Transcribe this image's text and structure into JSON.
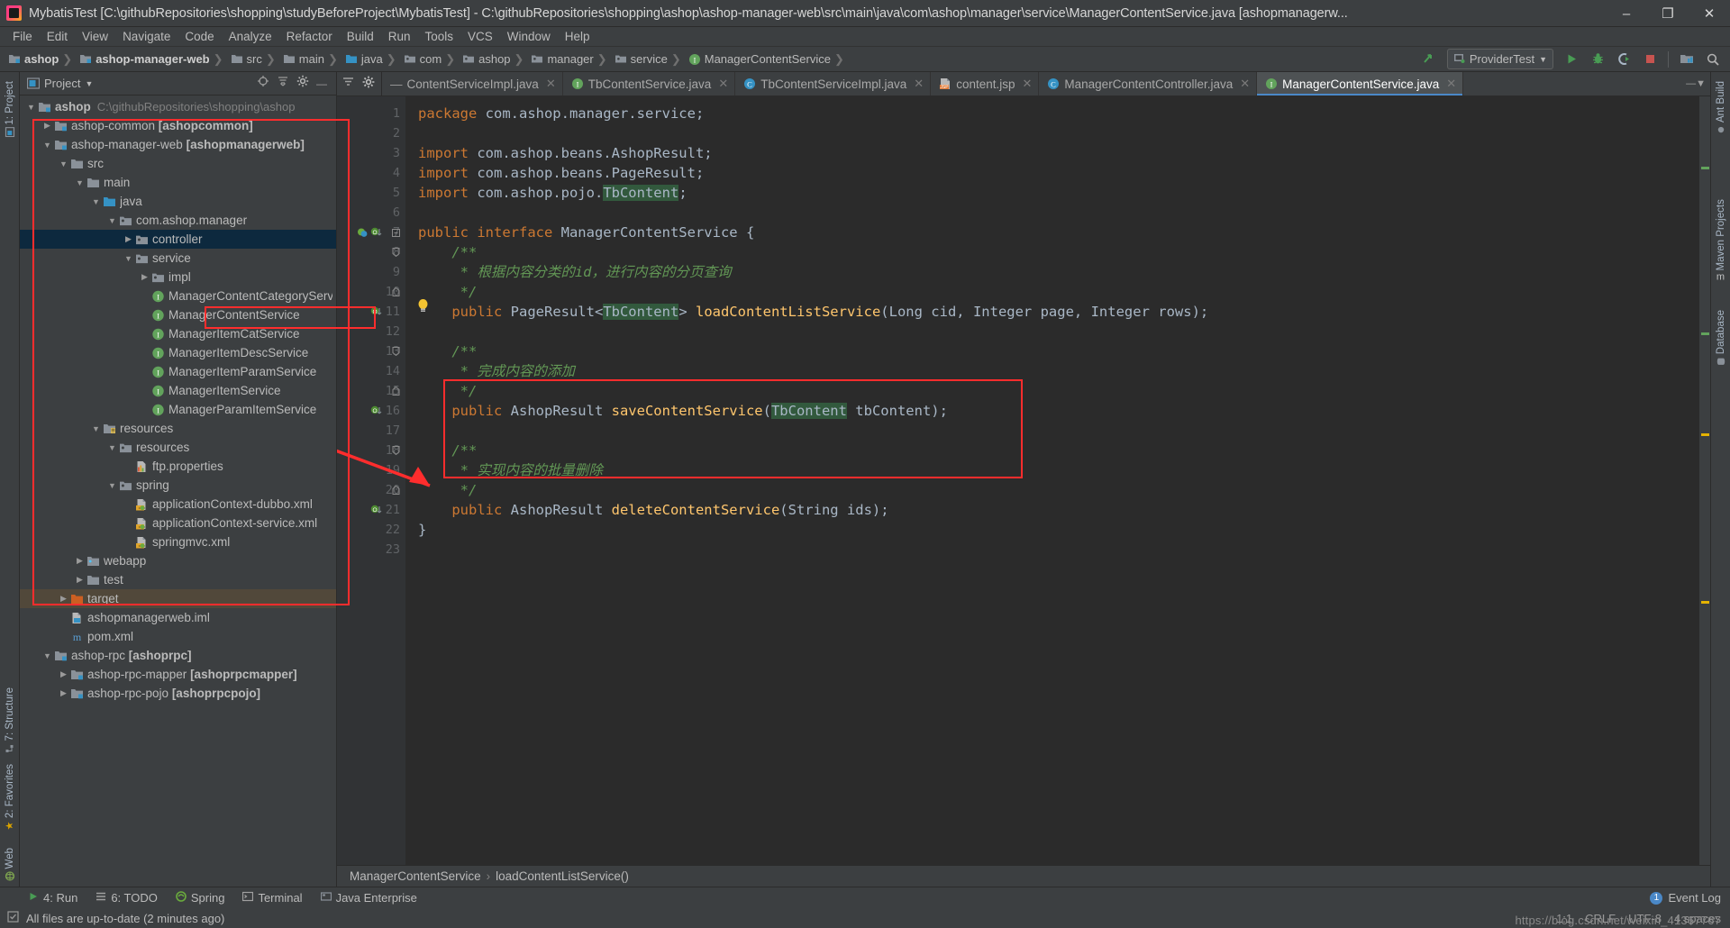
{
  "titlebar": {
    "title": "MybatisTest [C:\\githubRepositories\\shopping\\studyBeforeProject\\MybatisTest] - C:\\githubRepositories\\shopping\\ashop\\ashop-manager-web\\src\\main\\java\\com\\ashop\\manager\\service\\ManagerContentService.java [ashopmanagerw...",
    "minimize": "–",
    "maximize": "❐",
    "close": "✕"
  },
  "menubar": {
    "items": [
      "File",
      "Edit",
      "View",
      "Navigate",
      "Code",
      "Analyze",
      "Refactor",
      "Build",
      "Run",
      "Tools",
      "VCS",
      "Window",
      "Help"
    ]
  },
  "navbar": {
    "crumbs": [
      {
        "label": "ashop",
        "icon": "module-folder-icon",
        "bold": true
      },
      {
        "label": "ashop-manager-web",
        "icon": "module-folder-icon",
        "bold": true
      },
      {
        "label": "src",
        "icon": "folder-icon",
        "bold": false
      },
      {
        "label": "main",
        "icon": "folder-icon",
        "bold": false
      },
      {
        "label": "java",
        "icon": "source-folder-icon",
        "bold": false
      },
      {
        "label": "com",
        "icon": "package-icon",
        "bold": false
      },
      {
        "label": "ashop",
        "icon": "package-icon",
        "bold": false
      },
      {
        "label": "manager",
        "icon": "package-icon",
        "bold": false
      },
      {
        "label": "service",
        "icon": "package-icon",
        "bold": false
      },
      {
        "label": "ManagerContentService",
        "icon": "interface-icon",
        "bold": false
      }
    ],
    "run_config": "ProviderTest",
    "buttons": [
      "update-project-icon",
      "run-icon",
      "debug-icon",
      "run-coverage-icon",
      "stop-icon",
      "project-structure-icon",
      "search-everywhere-icon"
    ]
  },
  "left_strip": {
    "top_tabs": [
      {
        "label": "1: Project",
        "icon": "project-icon"
      }
    ],
    "bottom_tabs": [
      {
        "label": "7: Structure",
        "icon": "structure-icon"
      },
      {
        "label": "2: Favorites",
        "icon": "favorites-icon"
      },
      {
        "label": "Web",
        "icon": "web-icon"
      }
    ]
  },
  "right_strip": {
    "tabs": [
      {
        "label": "Ant Build",
        "icon": "ant-icon"
      },
      {
        "label": "Maven Projects",
        "icon": "maven-icon"
      },
      {
        "label": "Database",
        "icon": "database-icon"
      }
    ]
  },
  "project_panel": {
    "title": "Project",
    "header_icons": [
      "target-icon",
      "collapse-all-icon",
      "settings-icon",
      "hide-icon"
    ],
    "tree": [
      {
        "indent": 0,
        "arrow": "down",
        "icon": "module-folder-icon",
        "label": "ashop",
        "bold": true,
        "path": "C:\\githubRepositories\\shopping\\ashop",
        "state": "normal"
      },
      {
        "indent": 1,
        "arrow": "right",
        "icon": "module-folder-icon",
        "label": "ashop-common [ashopcommon]",
        "bold_part": "[ashopcommon]",
        "state": "normal"
      },
      {
        "indent": 1,
        "arrow": "down",
        "icon": "module-folder-icon",
        "label": "ashop-manager-web [ashopmanagerweb]",
        "bold_part": "[ashopmanagerweb]",
        "state": "normal"
      },
      {
        "indent": 2,
        "arrow": "down",
        "icon": "folder-icon",
        "label": "src",
        "state": "normal"
      },
      {
        "indent": 3,
        "arrow": "down",
        "icon": "folder-icon",
        "label": "main",
        "state": "normal"
      },
      {
        "indent": 4,
        "arrow": "down",
        "icon": "source-folder-icon",
        "label": "java",
        "state": "normal"
      },
      {
        "indent": 5,
        "arrow": "down",
        "icon": "package-icon",
        "label": "com.ashop.manager",
        "state": "normal"
      },
      {
        "indent": 6,
        "arrow": "right",
        "icon": "package-icon",
        "label": "controller",
        "state": "selected"
      },
      {
        "indent": 6,
        "arrow": "down",
        "icon": "package-icon",
        "label": "service",
        "state": "normal"
      },
      {
        "indent": 7,
        "arrow": "right",
        "icon": "package-icon",
        "label": "impl",
        "state": "normal"
      },
      {
        "indent": 7,
        "arrow": "none",
        "icon": "interface-icon",
        "label": "ManagerContentCategoryService",
        "state": "normal"
      },
      {
        "indent": 7,
        "arrow": "none",
        "icon": "interface-icon",
        "label": "ManagerContentService",
        "state": "annotated"
      },
      {
        "indent": 7,
        "arrow": "none",
        "icon": "interface-icon",
        "label": "ManagerItemCatService",
        "state": "normal"
      },
      {
        "indent": 7,
        "arrow": "none",
        "icon": "interface-icon",
        "label": "ManagerItemDescService",
        "state": "normal"
      },
      {
        "indent": 7,
        "arrow": "none",
        "icon": "interface-icon",
        "label": "ManagerItemParamService",
        "state": "normal"
      },
      {
        "indent": 7,
        "arrow": "none",
        "icon": "interface-icon",
        "label": "ManagerItemService",
        "state": "normal"
      },
      {
        "indent": 7,
        "arrow": "none",
        "icon": "interface-icon",
        "label": "ManagerParamItemService",
        "state": "normal"
      },
      {
        "indent": 4,
        "arrow": "down",
        "icon": "resource-folder-icon",
        "label": "resources",
        "state": "normal"
      },
      {
        "indent": 5,
        "arrow": "down",
        "icon": "package-icon",
        "label": "resources",
        "state": "normal"
      },
      {
        "indent": 6,
        "arrow": "none",
        "icon": "properties-icon",
        "label": "ftp.properties",
        "state": "normal"
      },
      {
        "indent": 5,
        "arrow": "down",
        "icon": "package-icon",
        "label": "spring",
        "state": "normal"
      },
      {
        "indent": 6,
        "arrow": "none",
        "icon": "spring-xml-icon",
        "label": "applicationContext-dubbo.xml",
        "state": "normal"
      },
      {
        "indent": 6,
        "arrow": "none",
        "icon": "spring-xml-icon",
        "label": "applicationContext-service.xml",
        "state": "normal"
      },
      {
        "indent": 6,
        "arrow": "none",
        "icon": "spring-xml-icon",
        "label": "springmvc.xml",
        "state": "normal"
      },
      {
        "indent": 3,
        "arrow": "right",
        "icon": "webapp-folder-icon",
        "label": "webapp",
        "state": "normal"
      },
      {
        "indent": 3,
        "arrow": "right",
        "icon": "folder-icon",
        "label": "test",
        "state": "normal"
      },
      {
        "indent": 2,
        "arrow": "right",
        "icon": "target-folder-icon",
        "label": "target",
        "state": "highlighted"
      },
      {
        "indent": 2,
        "arrow": "none",
        "icon": "iml-icon",
        "label": "ashopmanagerweb.iml",
        "state": "normal"
      },
      {
        "indent": 2,
        "arrow": "none",
        "icon": "maven-pom-icon",
        "label": "pom.xml",
        "state": "normal"
      },
      {
        "indent": 1,
        "arrow": "down",
        "icon": "module-folder-icon",
        "label": "ashop-rpc [ashoprpc]",
        "bold_part": "[ashoprpc]",
        "state": "normal"
      },
      {
        "indent": 2,
        "arrow": "right",
        "icon": "module-folder-icon",
        "label": "ashop-rpc-mapper [ashoprpcmapper]",
        "bold_part": "[ashoprpcmapper]",
        "state": "normal"
      },
      {
        "indent": 2,
        "arrow": "right",
        "icon": "module-folder-icon",
        "label": "ashop-rpc-pojo [ashoprpcpojo]",
        "bold_part": "[ashoprpcpojo]",
        "state": "normal"
      }
    ]
  },
  "editor": {
    "tabs": [
      {
        "label": "ContentServiceImpl.java",
        "icon": "minus-icon",
        "active": false,
        "closable": true
      },
      {
        "label": "TbContentService.java",
        "icon": "interface-icon",
        "active": false,
        "closable": true
      },
      {
        "label": "TbContentServiceImpl.java",
        "icon": "class-icon",
        "active": false,
        "closable": true
      },
      {
        "label": "content.jsp",
        "icon": "jsp-icon",
        "active": false,
        "closable": true
      },
      {
        "label": "ManagerContentController.java",
        "icon": "class-icon",
        "active": false,
        "closable": true
      },
      {
        "label": "ManagerContentService.java",
        "icon": "interface-icon",
        "active": true,
        "closable": true
      }
    ],
    "line_numbers": [
      1,
      2,
      3,
      4,
      5,
      6,
      7,
      8,
      9,
      10,
      11,
      12,
      13,
      14,
      15,
      16,
      17,
      18,
      19,
      20,
      21,
      22,
      23
    ],
    "code_lines": [
      {
        "n": 1,
        "segments": [
          {
            "t": "package ",
            "c": "kw"
          },
          {
            "t": "com.ashop.manager.service",
            "c": "ident"
          },
          {
            "t": ";",
            "c": "ident"
          }
        ]
      },
      {
        "n": 2,
        "segments": []
      },
      {
        "n": 3,
        "segments": [
          {
            "t": "import ",
            "c": "kw"
          },
          {
            "t": "com.ashop.beans.AshopResult;",
            "c": "ident"
          }
        ]
      },
      {
        "n": 4,
        "segments": [
          {
            "t": "import ",
            "c": "kw"
          },
          {
            "t": "com.ashop.beans.PageResult;",
            "c": "ident"
          }
        ]
      },
      {
        "n": 5,
        "segments": [
          {
            "t": "import ",
            "c": "kw"
          },
          {
            "t": "com.ashop.pojo.",
            "c": "ident"
          },
          {
            "t": "TbContent",
            "c": "hl"
          },
          {
            "t": ";",
            "c": "ident"
          }
        ]
      },
      {
        "n": 6,
        "segments": []
      },
      {
        "n": 7,
        "segments": [
          {
            "t": "public interface ",
            "c": "kw"
          },
          {
            "t": "ManagerContentService",
            "c": "ident"
          },
          {
            "t": " {",
            "c": "ident"
          }
        ]
      },
      {
        "n": 8,
        "segments": [
          {
            "t": "    /**",
            "c": "cmt"
          }
        ]
      },
      {
        "n": 9,
        "segments": [
          {
            "t": "     * 根据内容分类的id，进行内容的分页查询",
            "c": "cmt"
          }
        ]
      },
      {
        "n": 10,
        "segments": [
          {
            "t": "     */",
            "c": "cmt"
          }
        ]
      },
      {
        "n": 11,
        "segments": [
          {
            "t": "    public ",
            "c": "kw"
          },
          {
            "t": "PageResult<",
            "c": "ident"
          },
          {
            "t": "TbContent",
            "c": "hl"
          },
          {
            "t": "> ",
            "c": "ident"
          },
          {
            "t": "loadContentListService",
            "c": "mth"
          },
          {
            "t": "(Long cid, Integer page, Integer rows);",
            "c": "ident"
          }
        ]
      },
      {
        "n": 12,
        "segments": []
      },
      {
        "n": 13,
        "segments": [
          {
            "t": "    /**",
            "c": "cmt"
          }
        ]
      },
      {
        "n": 14,
        "segments": [
          {
            "t": "     * 完成内容的添加",
            "c": "cmt"
          }
        ]
      },
      {
        "n": 15,
        "segments": [
          {
            "t": "     */",
            "c": "cmt"
          }
        ]
      },
      {
        "n": 16,
        "segments": [
          {
            "t": "    public ",
            "c": "kw"
          },
          {
            "t": "AshopResult ",
            "c": "ident"
          },
          {
            "t": "saveContentService",
            "c": "mth"
          },
          {
            "t": "(",
            "c": "ident"
          },
          {
            "t": "TbContent",
            "c": "hl"
          },
          {
            "t": " tbContent);",
            "c": "ident"
          }
        ]
      },
      {
        "n": 17,
        "segments": []
      },
      {
        "n": 18,
        "segments": [
          {
            "t": "    /**",
            "c": "cmt"
          }
        ]
      },
      {
        "n": 19,
        "segments": [
          {
            "t": "     * 实现内容的批量删除",
            "c": "cmt"
          }
        ]
      },
      {
        "n": 20,
        "segments": [
          {
            "t": "     */",
            "c": "cmt"
          }
        ]
      },
      {
        "n": 21,
        "segments": [
          {
            "t": "    public ",
            "c": "kw"
          },
          {
            "t": "AshopResult ",
            "c": "ident"
          },
          {
            "t": "deleteContentService",
            "c": "mth"
          },
          {
            "t": "(String ids);",
            "c": "ident"
          }
        ]
      },
      {
        "n": 22,
        "segments": [
          {
            "t": "}",
            "c": "ident"
          }
        ]
      },
      {
        "n": 23,
        "segments": []
      }
    ],
    "breadcrumbs": [
      "ManagerContentService",
      "loadContentListService()"
    ],
    "breadcrumb_sep": "›"
  },
  "bottom_toolwindows": {
    "items": [
      {
        "label": "4: Run",
        "icon": "run-icon",
        "mnemonic": "4"
      },
      {
        "label": "6: TODO",
        "icon": "todo-icon",
        "mnemonic": "6"
      },
      {
        "label": "Spring",
        "icon": "spring-icon"
      },
      {
        "label": "Terminal",
        "icon": "terminal-icon"
      },
      {
        "label": "Java Enterprise",
        "icon": "java-ee-icon"
      }
    ],
    "event_log": "Event Log",
    "event_count": "1"
  },
  "statusbar": {
    "message": "All files are up-to-date (2 minutes ago)",
    "caret": "1:1",
    "line_sep": "CRLF",
    "encoding": "UTF-8",
    "indent": "4 spaces",
    "watermark": "https://blog.csdn.net/weixin_41367767"
  },
  "colors": {
    "accent": "#4a88c7",
    "annotation": "#ff2d2d",
    "interface_icon": "#62a35c",
    "class_icon": "#3592c4",
    "selection": "#0d293e"
  }
}
